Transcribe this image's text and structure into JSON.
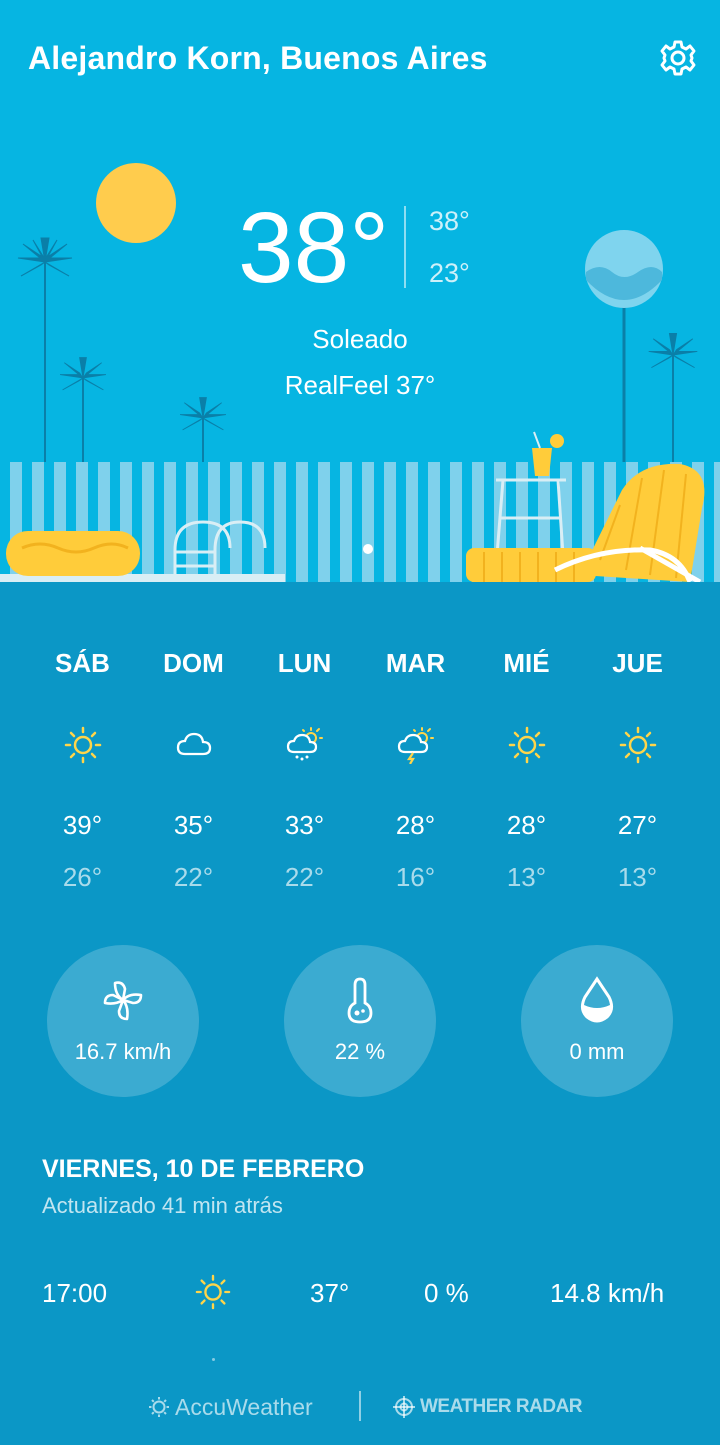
{
  "header": {
    "location": "Alejandro Korn, Buenos Aires",
    "settings_icon": "gear-icon"
  },
  "current": {
    "temperature": "38°",
    "high": "38°",
    "low": "23°",
    "condition": "Soleado",
    "realfeel": "RealFeel 37°"
  },
  "forecast": [
    {
      "day": "SÁB",
      "icon": "sun-icon",
      "high": "39°",
      "low": "26°"
    },
    {
      "day": "DOM",
      "icon": "cloud-icon",
      "high": "35°",
      "low": "22°"
    },
    {
      "day": "LUN",
      "icon": "sun-cloud-rain-icon",
      "high": "33°",
      "low": "22°"
    },
    {
      "day": "MAR",
      "icon": "sun-cloud-storm-icon",
      "high": "28°",
      "low": "16°"
    },
    {
      "day": "MIÉ",
      "icon": "sun-icon",
      "high": "28°",
      "low": "13°"
    },
    {
      "day": "JUE",
      "icon": "sun-icon",
      "high": "27°",
      "low": "13°"
    }
  ],
  "stats": {
    "wind": {
      "icon": "wind-icon",
      "value": "16.7 km/h"
    },
    "humidity": {
      "icon": "humidity-icon",
      "value": "22 %"
    },
    "precipitation": {
      "icon": "drop-icon",
      "value": "0 mm"
    }
  },
  "details": {
    "date": "VIERNES, 10 DE FEBRERO",
    "updated": "Actualizado 41 min atrás",
    "hourly": {
      "time": "17:00",
      "icon": "sun-icon",
      "temp": "37°",
      "precip": "0 %",
      "wind": "14.8 km/h"
    }
  },
  "footer": {
    "accuweather": "AccuWeather",
    "radar": "WEATHER RADAR"
  },
  "colors": {
    "sky": "#06b5e2",
    "panel": "#0b97c6",
    "sun": "#ffcc4d",
    "accent_yellow": "#ffd54a"
  }
}
